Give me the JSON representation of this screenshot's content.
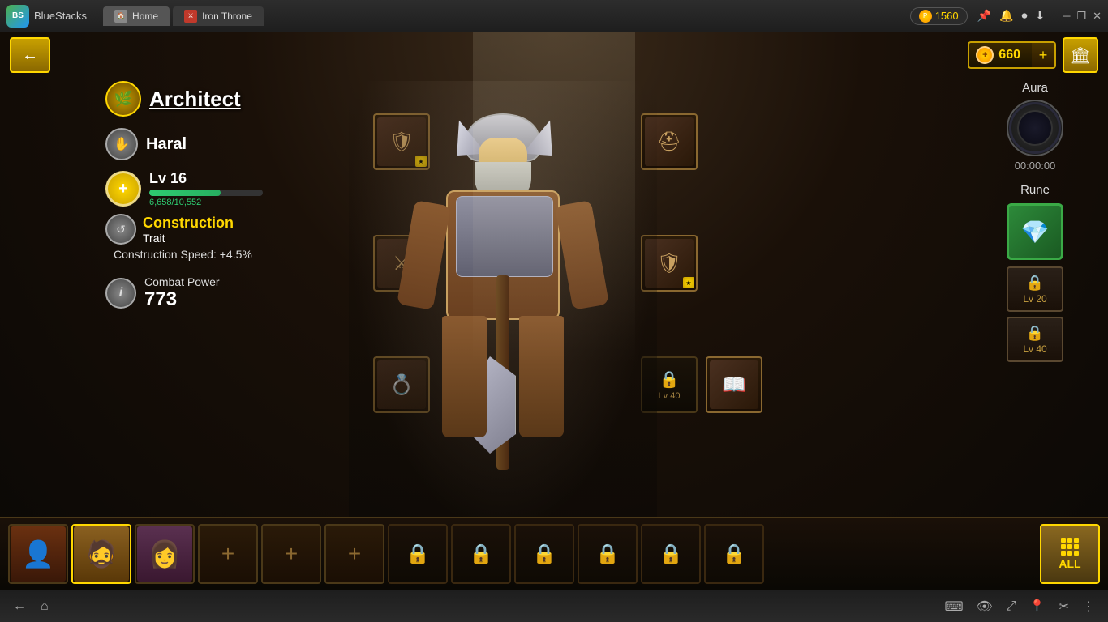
{
  "titlebar": {
    "bluestacks_label": "BlueStacks",
    "home_tab": "Home",
    "game_tab": "Iron Throne",
    "points": "1560",
    "points_label": "P"
  },
  "game": {
    "gold": "660",
    "hero_title": "Architect",
    "hero_name": "Haral",
    "level": "Lv 16",
    "xp_current": "6,658",
    "xp_max": "10,552",
    "xp_fraction": "6,658/10,552",
    "xp_percent": 63,
    "trait_name": "Construction",
    "trait_sub": "Trait",
    "trait_desc": "Construction Speed: +4.5%",
    "combat_label": "Combat Power",
    "combat_value": "773",
    "aura_label": "Aura",
    "aura_time": "00:00:00",
    "rune_label": "Rune",
    "rune_lv1": "Lv 20",
    "rune_lv2": "Lv 40",
    "slot_lv1": "Lv 40"
  },
  "bottom_bar": {
    "all_label": "ALL"
  },
  "equipment_slots": [
    {
      "id": "chest",
      "icon": "🛡",
      "position": "top-left"
    },
    {
      "id": "helmet",
      "icon": "⛑",
      "position": "top-right"
    },
    {
      "id": "weapon",
      "icon": "⚔",
      "position": "mid-left"
    },
    {
      "id": "shield",
      "icon": "🛡",
      "position": "mid-right"
    },
    {
      "id": "ring",
      "icon": "💍",
      "position": "bot-left"
    },
    {
      "id": "locked1",
      "lv": "Lv 40",
      "position": "bot-right"
    }
  ]
}
